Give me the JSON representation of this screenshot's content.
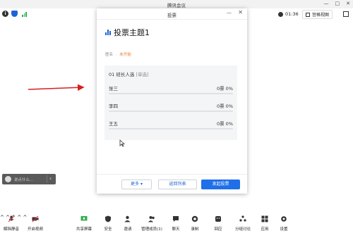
{
  "app": {
    "title": "腾讯会议",
    "controls": [
      "—",
      "□",
      "✕"
    ]
  },
  "status": {
    "timer": "01:36",
    "view_label": "宫格视图"
  },
  "dialog": {
    "title": "投票",
    "poll_title": "投票主题1",
    "meta_left": "匿名",
    "meta_sep": "·",
    "meta_status": "未开始",
    "question_no": "01",
    "question": "班长人选",
    "question_type": "[单选]",
    "options": [
      {
        "name": "张三",
        "count": "0票 0%",
        "ratio": 0
      },
      {
        "name": "李四",
        "count": "0票 0%",
        "ratio": 0
      },
      {
        "name": "王五",
        "count": "0票 0%",
        "ratio": 0
      }
    ],
    "more_label": "更多 ▾",
    "back_label": "返回列表",
    "start_label": "发起投票"
  },
  "chat": {
    "placeholder": "说点什么..."
  },
  "toolbar": {
    "mute": "解除静音",
    "video": "开启视频",
    "share": "共享屏幕",
    "security": "安全",
    "invite": "邀请",
    "members": "管理成员(1)",
    "chat": "聊天",
    "record": "录制",
    "reaction": "回应",
    "breakout": "分组讨论",
    "apps": "应用",
    "settings": "设置"
  },
  "colors": {
    "accent": "#1e6fe8",
    "annotation": "#d62020",
    "status_orange": "#f07a2a",
    "signal_green": "#2fae4f"
  }
}
